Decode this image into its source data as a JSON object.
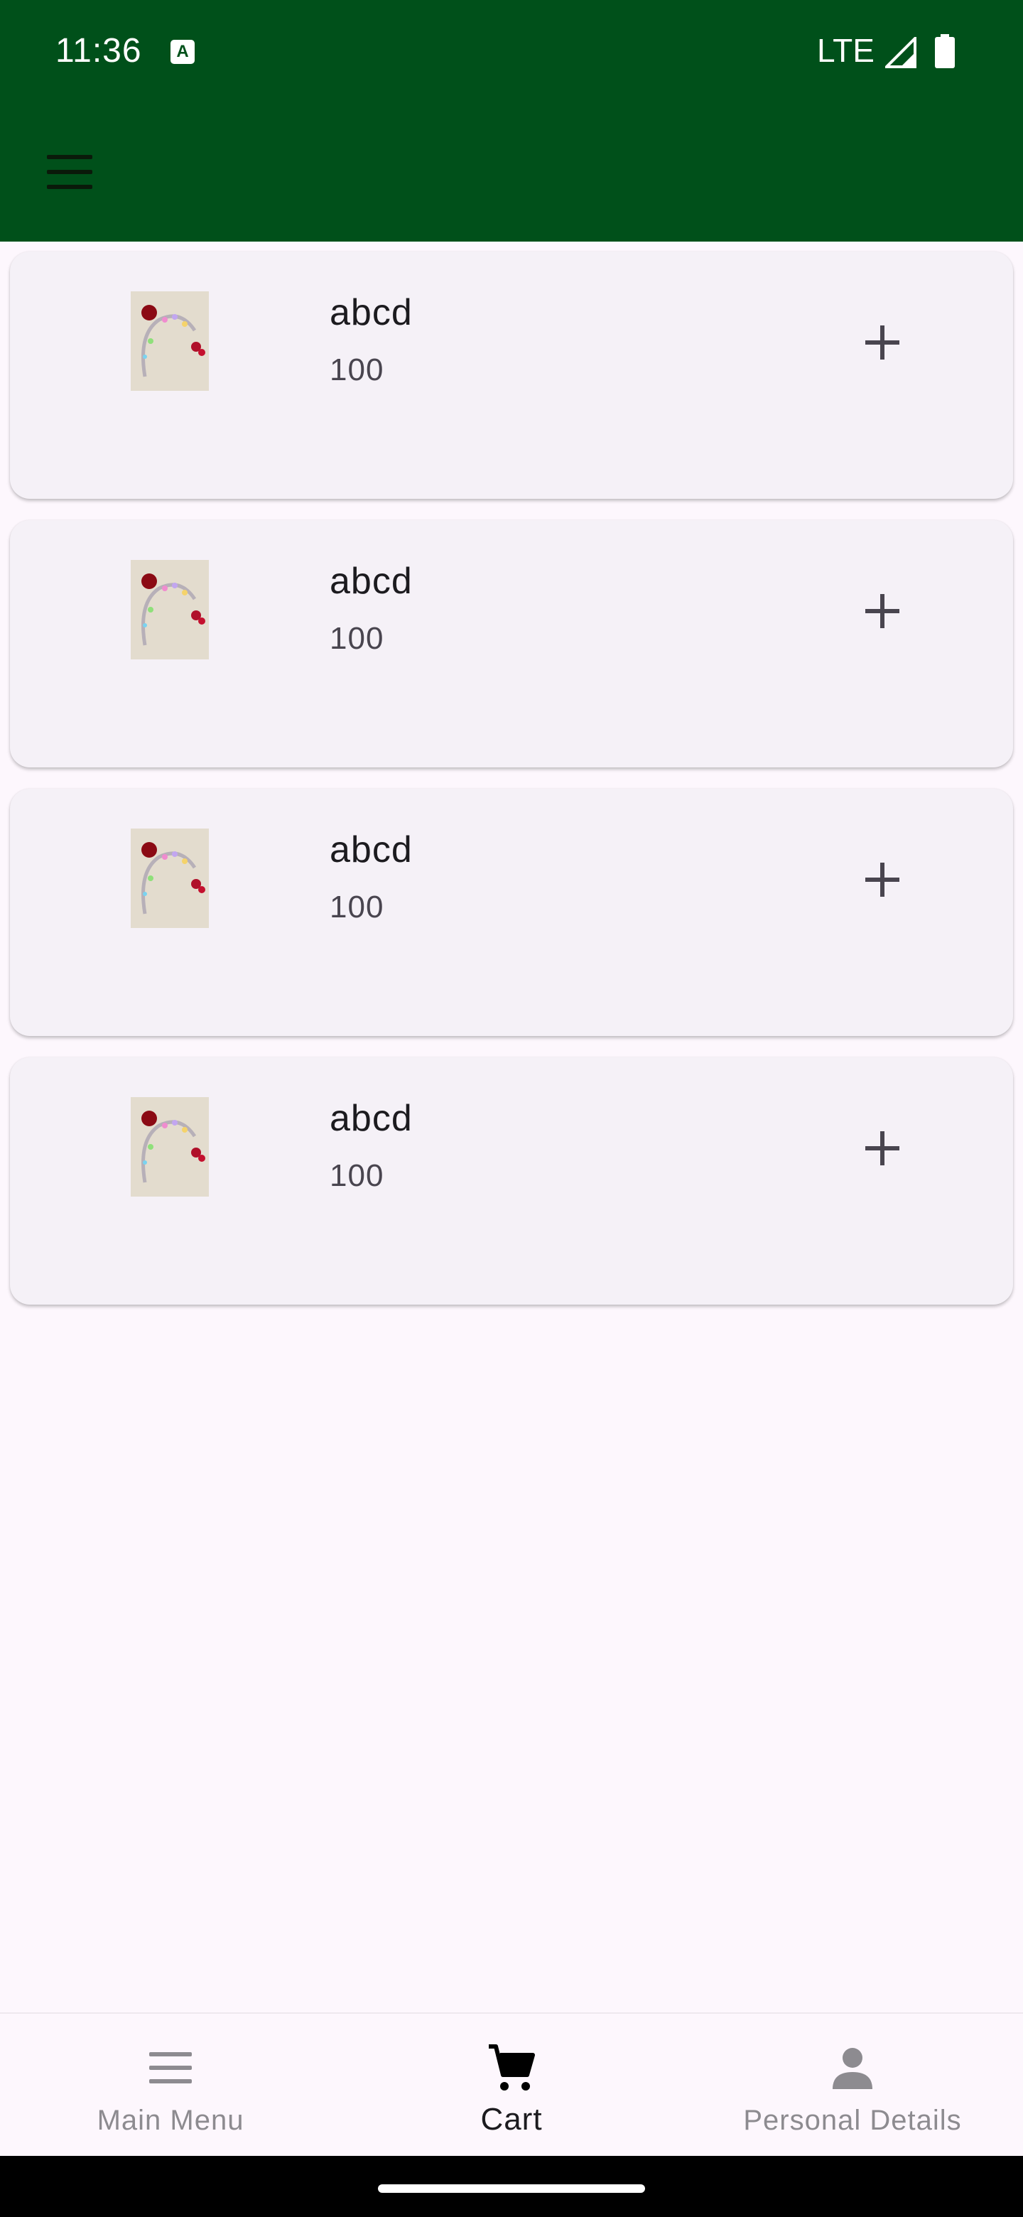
{
  "status_bar": {
    "time": "11:36",
    "notification_icon": "A",
    "network": "LTE"
  },
  "app_bar": {
    "menu_icon": "menu-icon"
  },
  "products": [
    {
      "name": "abcd",
      "price": "100"
    },
    {
      "name": "abcd",
      "price": "100"
    },
    {
      "name": "abcd",
      "price": "100"
    },
    {
      "name": "abcd",
      "price": "100"
    }
  ],
  "bottom_nav": {
    "items": [
      {
        "label": "Main Menu",
        "icon": "menu-icon"
      },
      {
        "label": "Cart",
        "icon": "cart-icon"
      },
      {
        "label": "Personal Details",
        "icon": "person-icon"
      }
    ],
    "active": "Cart"
  },
  "colors": {
    "app_bar": "#00501a",
    "background": "#fdf7fd",
    "card": "#f5f1f7"
  }
}
